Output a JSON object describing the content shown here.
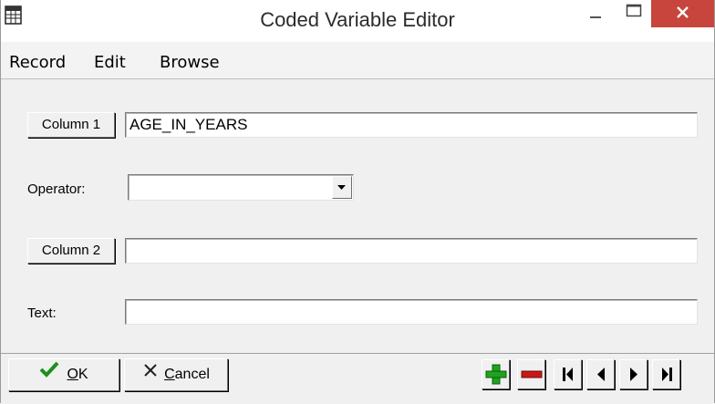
{
  "window": {
    "title": "Coded Variable Editor",
    "icon": "grid-app-icon",
    "controls": [
      "minimize-icon",
      "maximize-icon",
      "close-icon"
    ],
    "close_color": "#c7453c"
  },
  "menu": {
    "items": [
      {
        "label": "Record"
      },
      {
        "label": "Edit"
      },
      {
        "label": "Browse"
      }
    ]
  },
  "form": {
    "column1_button": "Column 1",
    "column1_value": "AGE_IN_YEARS",
    "operator_label": "Operator:",
    "operator_value": "",
    "column2_button": "Column 2",
    "column2_value": "",
    "text_label": "Text:",
    "text_value": ""
  },
  "footer": {
    "ok_label": "OK",
    "ok_accel": "O",
    "ok_rest": "K",
    "cancel_label": "Cancel",
    "cancel_accel": "C",
    "cancel_rest": "ancel",
    "nav_icons": [
      "add-record-icon",
      "delete-record-icon",
      "first-record-icon",
      "previous-record-icon",
      "next-record-icon",
      "last-record-icon"
    ],
    "add_color": "#1fa31f",
    "delete_color": "#c81818"
  }
}
